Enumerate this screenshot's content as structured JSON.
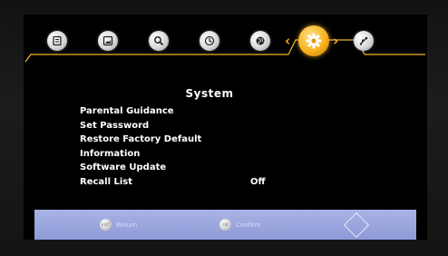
{
  "menu": {
    "icons": [
      {
        "name": "program-guide-icon"
      },
      {
        "name": "picture-icon"
      },
      {
        "name": "search-icon"
      },
      {
        "name": "clock-icon"
      },
      {
        "name": "globe-icon"
      },
      {
        "name": "settings-gear-icon",
        "active": true
      },
      {
        "name": "usb-icon"
      }
    ],
    "active_color": "#F3B52A"
  },
  "panel": {
    "title": "System",
    "items": [
      {
        "label": "Parental Guidance",
        "value": ""
      },
      {
        "label": "Set Password",
        "value": ""
      },
      {
        "label": "Restore Factory Default",
        "value": ""
      },
      {
        "label": "Information",
        "value": ""
      },
      {
        "label": "Software Update",
        "value": ""
      },
      {
        "label": "Recall List",
        "value": "Off"
      }
    ]
  },
  "footer": {
    "return_button": "EXIT",
    "return_label": "Return",
    "confirm_button": "OK",
    "confirm_label": "Confirm",
    "bar_color": "#A9B3E6"
  }
}
